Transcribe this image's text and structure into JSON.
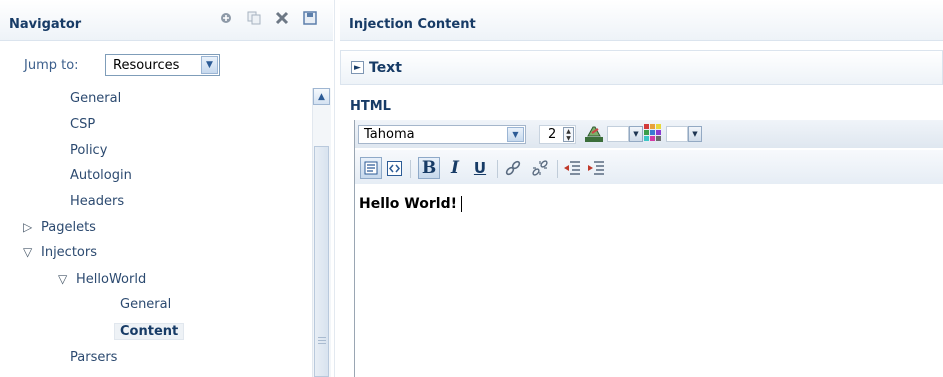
{
  "navigator": {
    "title": "Navigator",
    "toolbar_icons": [
      "add-icon",
      "copy-icon",
      "delete-icon",
      "save-icon"
    ],
    "jump_to": {
      "label": "Jump to:",
      "value": "Resources"
    },
    "tree": [
      {
        "label": "General",
        "indent": 1,
        "twisty": ""
      },
      {
        "label": "CSP",
        "indent": 1,
        "twisty": ""
      },
      {
        "label": "Policy",
        "indent": 1,
        "twisty": ""
      },
      {
        "label": "Autologin",
        "indent": 1,
        "twisty": ""
      },
      {
        "label": "Headers",
        "indent": 1,
        "twisty": ""
      },
      {
        "label": "Pagelets",
        "indent": 0,
        "twisty": "collapsed"
      },
      {
        "label": "Injectors",
        "indent": 0,
        "twisty": "expanded"
      },
      {
        "label": "HelloWorld",
        "indent": 1,
        "twisty": "expanded"
      },
      {
        "label": "General",
        "indent": 2,
        "twisty": ""
      },
      {
        "label": "Content",
        "indent": 2,
        "twisty": "",
        "selected": true
      },
      {
        "label": "Parsers",
        "indent": 1,
        "twisty": ""
      }
    ]
  },
  "main": {
    "title": "Injection Content",
    "text_section": {
      "label": "Text"
    },
    "html_section": {
      "label": "HTML",
      "toolbar": {
        "font": "Tahoma",
        "size": "2"
      },
      "format_buttons": [
        {
          "name": "design-view-button",
          "active": true
        },
        {
          "name": "source-view-button",
          "active": false
        },
        {
          "name": "bold-button",
          "glyph": "B",
          "active": true
        },
        {
          "name": "italic-button",
          "glyph": "I",
          "active": false
        },
        {
          "name": "underline-button",
          "glyph": "U",
          "active": false
        },
        {
          "name": "link-button",
          "active": false
        },
        {
          "name": "unlink-button",
          "active": false
        },
        {
          "name": "outdent-button",
          "active": false
        },
        {
          "name": "indent-button",
          "active": false
        }
      ],
      "content": "Hello World!"
    }
  },
  "colors": {
    "header_text": "#173b66",
    "tree_text": "#2c4a70",
    "accent_blue": "#2c5b96"
  }
}
